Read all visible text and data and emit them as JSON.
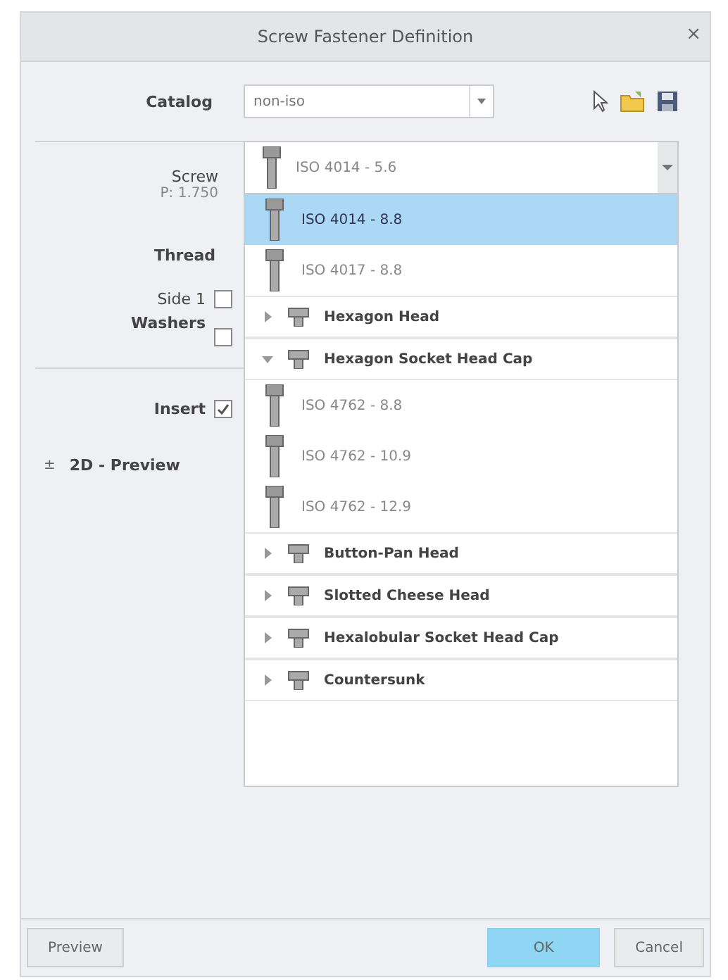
{
  "window": {
    "title": "Screw Fastener Definition",
    "close": "×"
  },
  "catalog": {
    "label": "Catalog",
    "value": "non-iso"
  },
  "screw": {
    "label": "Screw",
    "pitch": "P: 1.750",
    "value": "ISO 4014 - 5.6"
  },
  "thread": {
    "label": "Thread"
  },
  "washers": {
    "label_1": "Side 1",
    "label_2": "Washers",
    "checkboxes": [
      {
        "checked": false
      },
      {
        "checked": false
      }
    ]
  },
  "insert": {
    "label": "Insert",
    "checked": true
  },
  "preview_section": {
    "toggle": "±",
    "label": "2D - Preview"
  },
  "list": [
    {
      "kind": "leaf",
      "label": "ISO 4014 - 8.8",
      "selected": true
    },
    {
      "kind": "leaf",
      "label": "ISO 4017 - 8.8",
      "selected": false
    },
    {
      "kind": "group",
      "label": "Hexagon Head",
      "expanded": false
    },
    {
      "kind": "group",
      "label": "Hexagon Socket Head Cap",
      "expanded": true,
      "children": [
        {
          "kind": "leaf",
          "label": "ISO 4762 - 8.8",
          "selected": false
        },
        {
          "kind": "leaf",
          "label": "ISO 4762 - 10.9",
          "selected": false
        },
        {
          "kind": "leaf",
          "label": "ISO 4762 - 12.9",
          "selected": false
        }
      ]
    },
    {
      "kind": "group",
      "label": "Button-Pan Head",
      "expanded": false
    },
    {
      "kind": "group",
      "label": "Slotted Cheese Head",
      "expanded": false
    },
    {
      "kind": "group",
      "label": "Hexalobular Socket Head Cap",
      "expanded": false
    },
    {
      "kind": "group",
      "label": "Countersunk",
      "expanded": false
    }
  ],
  "buttons": [
    {
      "kind": "secondary",
      "label": "Preview"
    },
    {
      "kind": "primary",
      "label": "OK"
    },
    {
      "kind": "secondary",
      "label": "Cancel"
    }
  ]
}
